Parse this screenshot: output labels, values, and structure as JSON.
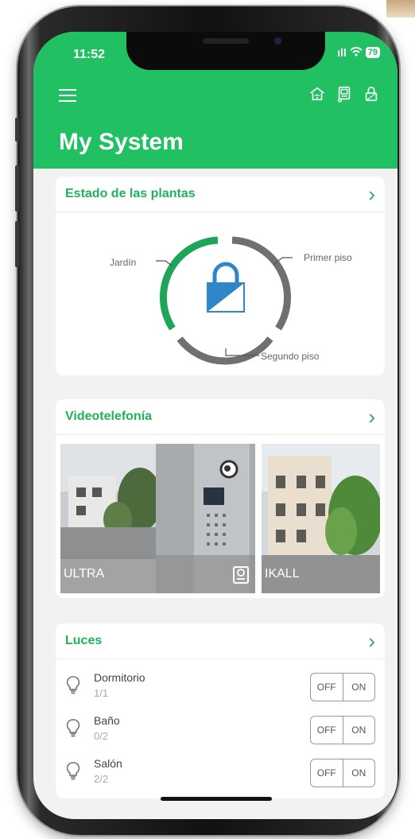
{
  "status_bar": {
    "time": "11:52",
    "signal": "..ıl",
    "wifi": "wifi",
    "battery": "79"
  },
  "header": {
    "title": "My System",
    "menu_icon": "hamburger-icon",
    "icons": [
      "home-wifi-icon",
      "intercom-icon",
      "lock-icon"
    ]
  },
  "colors": {
    "brand": "#20c063",
    "accent_text": "#1fb35a",
    "lock_blue": "#2f86c8"
  },
  "plantas": {
    "title": "Estado de las plantas",
    "labels": {
      "jardin": "Jardín",
      "primer": "Primer piso",
      "segundo": "Segundo piso"
    }
  },
  "video": {
    "title": "Videotelefonía",
    "devices": [
      {
        "label": "ULTRA"
      },
      {
        "label": "IKALL"
      }
    ]
  },
  "luces": {
    "title": "Luces",
    "items": [
      {
        "name": "Dormitorio",
        "count": "1/1",
        "off": "OFF",
        "on": "ON"
      },
      {
        "name": "Baño",
        "count": "0/2",
        "off": "OFF",
        "on": "ON"
      },
      {
        "name": "Salón",
        "count": "2/2",
        "off": "OFF",
        "on": "ON"
      }
    ]
  }
}
